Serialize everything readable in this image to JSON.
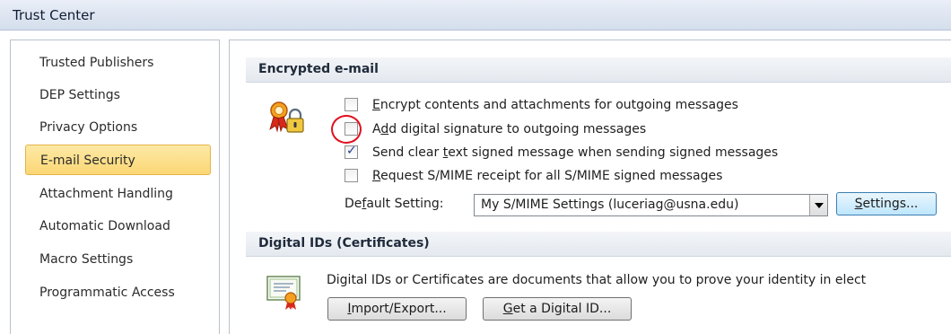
{
  "window": {
    "title": "Trust Center"
  },
  "sidebar": {
    "items": [
      {
        "label": "Trusted Publishers",
        "selected": false
      },
      {
        "label": "DEP Settings",
        "selected": false
      },
      {
        "label": "Privacy Options",
        "selected": false
      },
      {
        "label": "E-mail Security",
        "selected": true
      },
      {
        "label": "Attachment Handling",
        "selected": false
      },
      {
        "label": "Automatic Download",
        "selected": false
      },
      {
        "label": "Macro Settings",
        "selected": false
      },
      {
        "label": "Programmatic Access",
        "selected": false
      }
    ]
  },
  "encrypted_email": {
    "header": "Encrypted e-mail",
    "icon": "certificate-lock-icon",
    "options": [
      {
        "pre": "",
        "key": "E",
        "post": "ncrypt contents and attachments for outgoing messages",
        "checked": false
      },
      {
        "pre": "A",
        "key": "d",
        "post": "d digital signature to outgoing messages",
        "checked": false
      },
      {
        "pre": "Send clear ",
        "key": "t",
        "post": "ext signed message when sending signed messages",
        "checked": true
      },
      {
        "pre": "",
        "key": "R",
        "post": "equest S/MIME receipt for all S/MIME signed messages",
        "checked": false
      }
    ],
    "default_setting": {
      "pre": "De",
      "key": "f",
      "post": "ault Setting:",
      "value": "My S/MIME Settings (luceriag@usna.edu)"
    },
    "settings_button": {
      "key": "S",
      "post": "ettings..."
    },
    "highlight_color": "#e0101e"
  },
  "digital_ids": {
    "header": "Digital IDs (Certificates)",
    "icon": "certificate-icon",
    "description": "Digital IDs or Certificates are documents that allow you to prove your identity in elect",
    "import_button": {
      "key": "I",
      "post": "mport/Export..."
    },
    "get_id_button": {
      "key": "G",
      "post": "et a Digital ID..."
    }
  },
  "colors": {
    "selected_bg": "#fbd775",
    "selected_border": "#e3b44a",
    "check_color": "#263f8a"
  }
}
